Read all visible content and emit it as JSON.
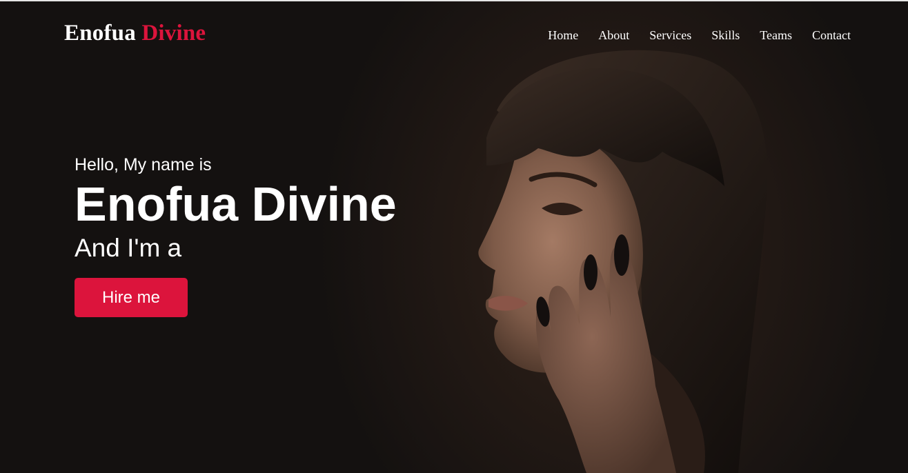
{
  "brand": {
    "name_first": "Enofua",
    "name_accent": "Divine"
  },
  "nav": {
    "items": [
      {
        "label": "Home"
      },
      {
        "label": "About"
      },
      {
        "label": "Services"
      },
      {
        "label": "Skills"
      },
      {
        "label": "Teams"
      },
      {
        "label": "Contact"
      }
    ]
  },
  "hero": {
    "greeting": "Hello, My name is",
    "name": "Enofua Divine",
    "role_prefix": "And I'm a",
    "cta_label": "Hire me"
  },
  "colors": {
    "accent": "#dc143c",
    "text": "#ffffff",
    "background": "#1a1512"
  }
}
